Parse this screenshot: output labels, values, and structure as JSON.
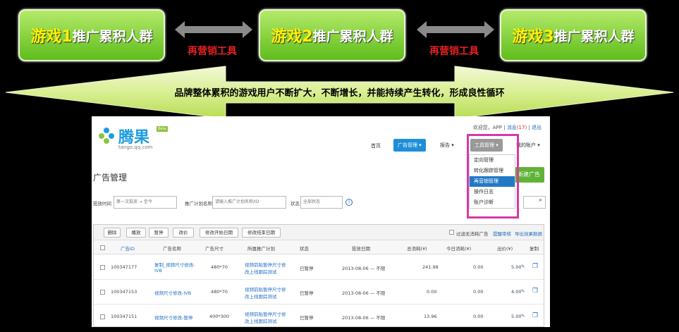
{
  "games": [
    {
      "highlight": "游戏1",
      "rest": "推广累积人群"
    },
    {
      "highlight": "游戏2",
      "rest": "推广累积人群"
    },
    {
      "highlight": "游戏3",
      "rest": "推广累积人群"
    }
  ],
  "retarget_label": "再营销工具",
  "banner_text": "品牌整体累积的游戏用户不断扩大，不断增长，并能持续产生转化，形成良性循环",
  "app": {
    "logo_text": "腾果",
    "logo_beta": "Beta",
    "logo_url": "tango.qq.com",
    "welcome": "欢迎您，APP",
    "messages": "消息",
    "msg_count": "(17)",
    "logout": "退出",
    "nav": {
      "home": "首页",
      "ad_mgmt": "广告管理",
      "report": "报告",
      "tools": "工具管理",
      "account": "我的账户"
    },
    "page_title": "广告管理",
    "new_btn": "新建广告",
    "filters": {
      "date_label": "投放时间",
      "date_value": "第一次投放 → 至今",
      "plan_label": "推广计划名称",
      "plan_placeholder": "请输入推广计划名称/ID",
      "status_label": "状态",
      "status_value": "全部状态",
      "help": "?"
    },
    "dropdown": [
      "定向管理",
      "转化跟踪管理",
      "再营销管理",
      "操作日志",
      "账户诊断"
    ],
    "toolbar": {
      "delete": "删除",
      "run": "播放",
      "pause": "暂停",
      "modify": "改价",
      "start_date": "修改开始日期",
      "end_date": "修改结束日期",
      "filter_label": "过滤无消耗广告",
      "remind": "提醒审核",
      "export": "导出效果数据"
    },
    "columns": [
      "广告ID",
      "广告名称",
      "广告尺寸",
      "所属推广计划",
      "状态",
      "投放日期",
      "总消耗(¥)",
      "今日消耗(¥)",
      "出价(¥)",
      "复制"
    ],
    "rows": [
      {
        "id": "100347177",
        "name": "复制_视频尺寸修改-IVB",
        "size": "480*70",
        "plan": "视频前贴暂停尺寸修改上线跟踪测试",
        "status": "已暂停",
        "date": "2013-08-06 — 不限",
        "total": "241.98",
        "today": "0.00",
        "bid": "5.00"
      },
      {
        "id": "100347153",
        "name": "视频尺寸修改-IVB",
        "size": "480*70",
        "plan": "视频前贴暂停尺寸修改上线跟踪测试",
        "status": "已暂停",
        "date": "2013-08-06 — 不限",
        "total": "0.00",
        "today": "0.00",
        "bid": "4.00"
      },
      {
        "id": "100347151",
        "name": "视频尺寸修改-暂停",
        "size": "400*300",
        "plan": "视频前贴暂停尺寸修改上线跟踪测试",
        "status": "已暂停",
        "date": "2013-08-06 — 不限",
        "total": "13.96",
        "today": "0.00",
        "bid": "5.00"
      }
    ]
  },
  "colors": {
    "green": "#5fbd1c",
    "highlight": "#fff200",
    "red": "#e52020",
    "magenta": "#d63aa6",
    "blue": "#2379c6"
  }
}
